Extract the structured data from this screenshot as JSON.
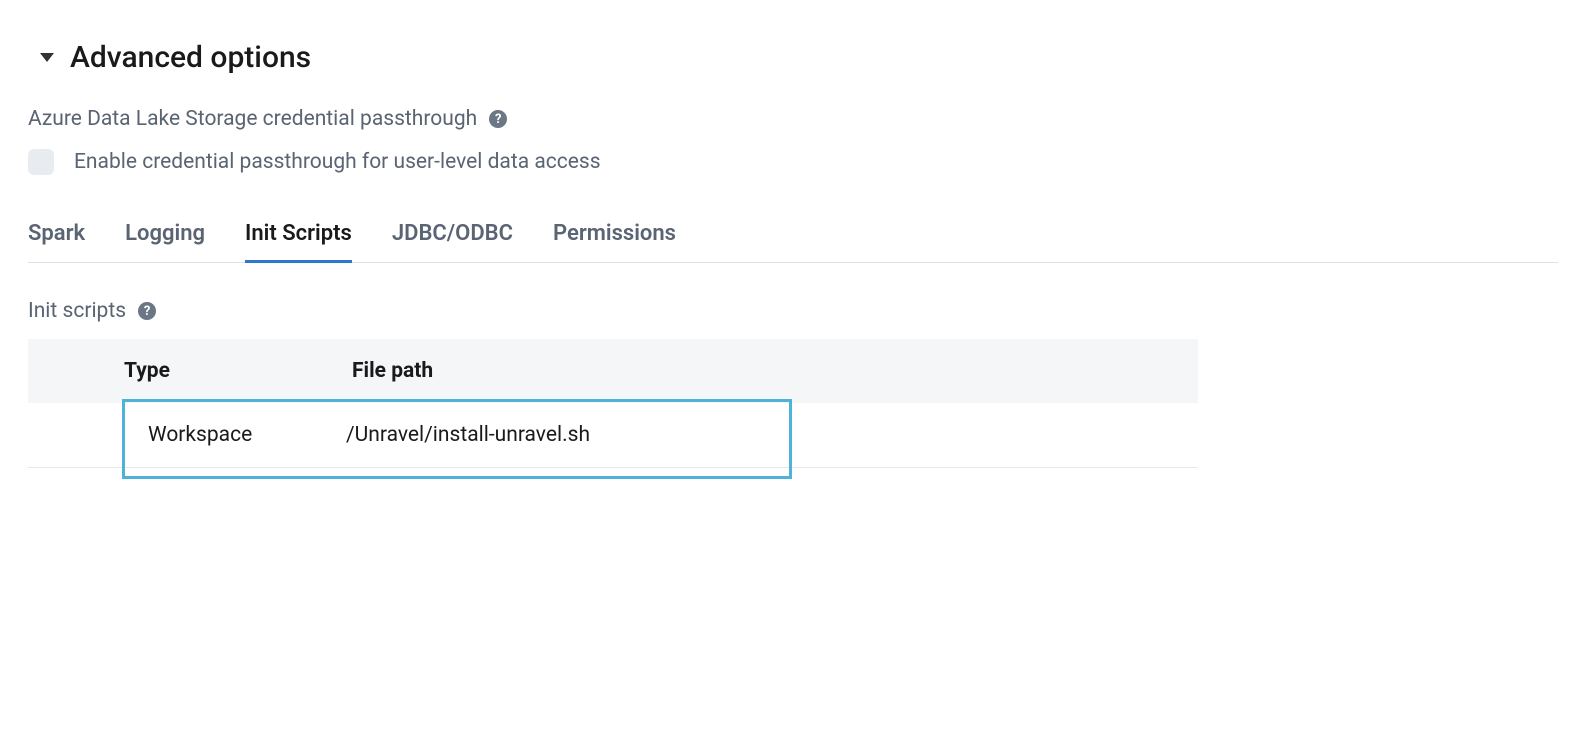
{
  "section": {
    "title": "Advanced options"
  },
  "passthrough": {
    "label": "Azure Data Lake Storage credential passthrough",
    "checkbox_label": "Enable credential passthrough for user-level data access"
  },
  "tabs": [
    {
      "label": "Spark",
      "active": false
    },
    {
      "label": "Logging",
      "active": false
    },
    {
      "label": "Init Scripts",
      "active": true
    },
    {
      "label": "JDBC/ODBC",
      "active": false
    },
    {
      "label": "Permissions",
      "active": false
    }
  ],
  "init_scripts": {
    "title": "Init scripts",
    "columns": {
      "type": "Type",
      "file_path": "File path"
    },
    "rows": [
      {
        "type": "Workspace",
        "file_path": "/Unravel/install-unravel.sh"
      }
    ]
  }
}
